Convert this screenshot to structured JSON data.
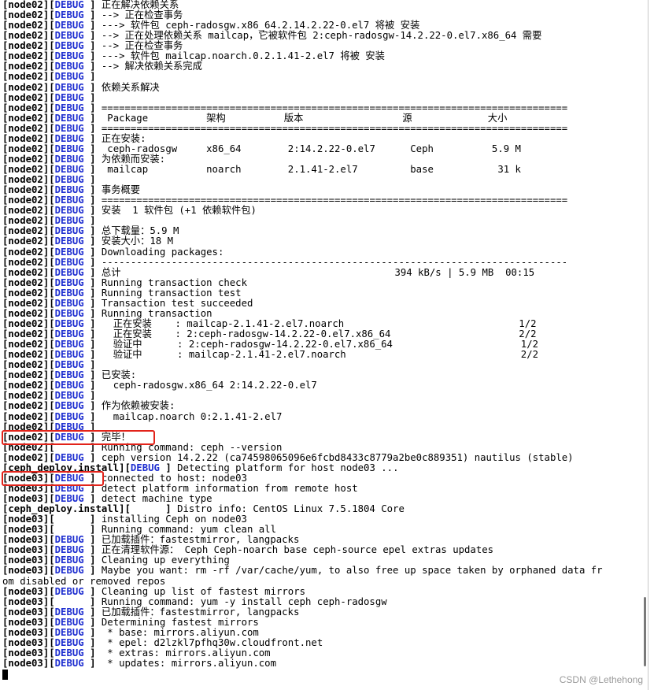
{
  "terminal": {
    "lines": [
      {
        "host": "node02",
        "level": "DEBUG",
        "msg": "正在解决依赖关系"
      },
      {
        "host": "node02",
        "level": "DEBUG",
        "msg": "--> 正在检查事务"
      },
      {
        "host": "node02",
        "level": "DEBUG",
        "msg": "---> 软件包 ceph-radosgw.x86_64.2.14.2.22-0.el7 将被 安装"
      },
      {
        "host": "node02",
        "level": "DEBUG",
        "msg": "--> 正在处理依赖关系 mailcap，它被软件包 2:ceph-radosgw-14.2.22-0.el7.x86_64 需要"
      },
      {
        "host": "node02",
        "level": "DEBUG",
        "msg": "--> 正在检查事务"
      },
      {
        "host": "node02",
        "level": "DEBUG",
        "msg": "---> 软件包 mailcap.noarch.0.2.1.41-2.el7 将被 安装"
      },
      {
        "host": "node02",
        "level": "DEBUG",
        "msg": "--> 解决依赖关系完成"
      },
      {
        "host": "node02",
        "level": "DEBUG",
        "msg": ""
      },
      {
        "host": "node02",
        "level": "DEBUG",
        "msg": "依赖关系解决"
      },
      {
        "host": "node02",
        "level": "DEBUG",
        "msg": ""
      },
      {
        "host": "node02",
        "level": "DEBUG",
        "msg": "================================================================================"
      },
      {
        "host": "node02",
        "level": "DEBUG",
        "msg": " Package          架构          版本                 源             大小"
      },
      {
        "host": "node02",
        "level": "DEBUG",
        "msg": "================================================================================"
      },
      {
        "host": "node02",
        "level": "DEBUG",
        "msg": "正在安装:"
      },
      {
        "host": "node02",
        "level": "DEBUG",
        "msg": " ceph-radosgw     x86_64        2:14.2.22-0.el7      Ceph          5.9 M"
      },
      {
        "host": "node02",
        "level": "DEBUG",
        "msg": "为依赖而安装:"
      },
      {
        "host": "node02",
        "level": "DEBUG",
        "msg": " mailcap          noarch        2.1.41-2.el7         base           31 k"
      },
      {
        "host": "node02",
        "level": "DEBUG",
        "msg": ""
      },
      {
        "host": "node02",
        "level": "DEBUG",
        "msg": "事务概要"
      },
      {
        "host": "node02",
        "level": "DEBUG",
        "msg": "================================================================================"
      },
      {
        "host": "node02",
        "level": "DEBUG",
        "msg": "安装  1 软件包 (+1 依赖软件包)"
      },
      {
        "host": "node02",
        "level": "DEBUG",
        "msg": ""
      },
      {
        "host": "node02",
        "level": "DEBUG",
        "msg": "总下载量：5.9 M"
      },
      {
        "host": "node02",
        "level": "DEBUG",
        "msg": "安装大小：18 M"
      },
      {
        "host": "node02",
        "level": "DEBUG",
        "msg": "Downloading packages:"
      },
      {
        "host": "node02",
        "level": "DEBUG",
        "msg": "--------------------------------------------------------------------------------"
      },
      {
        "host": "node02",
        "level": "DEBUG",
        "msg": "总计                                               394 kB/s | 5.9 MB  00:15"
      },
      {
        "host": "node02",
        "level": "DEBUG",
        "msg": "Running transaction check"
      },
      {
        "host": "node02",
        "level": "DEBUG",
        "msg": "Running transaction test"
      },
      {
        "host": "node02",
        "level": "DEBUG",
        "msg": "Transaction test succeeded"
      },
      {
        "host": "node02",
        "level": "DEBUG",
        "msg": "Running transaction"
      },
      {
        "host": "node02",
        "level": "DEBUG",
        "msg": "  正在安装    : mailcap-2.1.41-2.el7.noarch                              1/2"
      },
      {
        "host": "node02",
        "level": "DEBUG",
        "msg": "  正在安装    : 2:ceph-radosgw-14.2.22-0.el7.x86_64                      2/2"
      },
      {
        "host": "node02",
        "level": "DEBUG",
        "msg": "  验证中      : 2:ceph-radosgw-14.2.22-0.el7.x86_64                      1/2"
      },
      {
        "host": "node02",
        "level": "DEBUG",
        "msg": "  验证中      : mailcap-2.1.41-2.el7.noarch                              2/2"
      },
      {
        "host": "node02",
        "level": "DEBUG",
        "msg": ""
      },
      {
        "host": "node02",
        "level": "DEBUG",
        "msg": "已安装:"
      },
      {
        "host": "node02",
        "level": "DEBUG",
        "msg": "  ceph-radosgw.x86_64 2:14.2.22-0.el7"
      },
      {
        "host": "node02",
        "level": "DEBUG",
        "msg": ""
      },
      {
        "host": "node02",
        "level": "DEBUG",
        "msg": "作为依赖被安装:"
      },
      {
        "host": "node02",
        "level": "DEBUG",
        "msg": "  mailcap.noarch 0:2.1.41-2.el7"
      },
      {
        "host": "node02",
        "level": "DEBUG",
        "msg": ""
      },
      {
        "host": "node02",
        "level": "DEBUG",
        "msg": "完毕！"
      },
      {
        "host": "node02",
        "level": "",
        "msg": "Running command: ceph --version"
      },
      {
        "host": "node02",
        "level": "DEBUG",
        "msg": "ceph version 14.2.22 (ca74598065096e6fcbd8433c8779a2be0c889351) nautilus (stable)"
      },
      {
        "host": "ceph_deploy.install",
        "level": "DEBUG",
        "msg": "Detecting platform for host node03 ..."
      },
      {
        "host": "node03",
        "level": "DEBUG",
        "msg": "connected to host: node03"
      },
      {
        "host": "node03",
        "level": "DEBUG",
        "msg": "detect platform information from remote host"
      },
      {
        "host": "node03",
        "level": "DEBUG",
        "msg": "detect machine type"
      },
      {
        "host": "ceph_deploy.install",
        "level": "",
        "msg": "Distro info: CentOS Linux 7.5.1804 Core"
      },
      {
        "host": "node03",
        "level": "",
        "msg": "installing Ceph on node03"
      },
      {
        "host": "node03",
        "level": "",
        "msg": "Running command: yum clean all"
      },
      {
        "host": "node03",
        "level": "DEBUG",
        "msg": "已加载插件：fastestmirror, langpacks"
      },
      {
        "host": "node03",
        "level": "DEBUG",
        "msg": "正在清理软件源： Ceph Ceph-noarch base ceph-source epel extras updates"
      },
      {
        "host": "node03",
        "level": "DEBUG",
        "msg": "Cleaning up everything"
      },
      {
        "host": "node03",
        "level": "DEBUG",
        "msg": "Maybe you want: rm -rf /var/cache/yum, to also free up space taken by orphaned data fr"
      },
      {
        "host": "",
        "level": "",
        "msg": "om disabled or removed repos",
        "raw": true
      },
      {
        "host": "node03",
        "level": "DEBUG",
        "msg": "Cleaning up list of fastest mirrors"
      },
      {
        "host": "node03",
        "level": "",
        "msg": "Running command: yum -y install ceph ceph-radosgw"
      },
      {
        "host": "node03",
        "level": "DEBUG",
        "msg": "已加载插件：fastestmirror, langpacks"
      },
      {
        "host": "node03",
        "level": "DEBUG",
        "msg": "Determining fastest mirrors"
      },
      {
        "host": "node03",
        "level": "DEBUG",
        "msg": " * base: mirrors.aliyun.com"
      },
      {
        "host": "node03",
        "level": "DEBUG",
        "msg": " * epel: d2lzkl7pfhq30w.cloudfront.net"
      },
      {
        "host": "node03",
        "level": "DEBUG",
        "msg": " * extras: mirrors.aliyun.com"
      },
      {
        "host": "node03",
        "level": "DEBUG",
        "msg": " * updates: mirrors.aliyun.com"
      }
    ]
  },
  "watermark": "CSDN @Lethehong",
  "colors": {
    "debug_blue": "#1f2fd0",
    "highlight_red": "#e2231a"
  }
}
